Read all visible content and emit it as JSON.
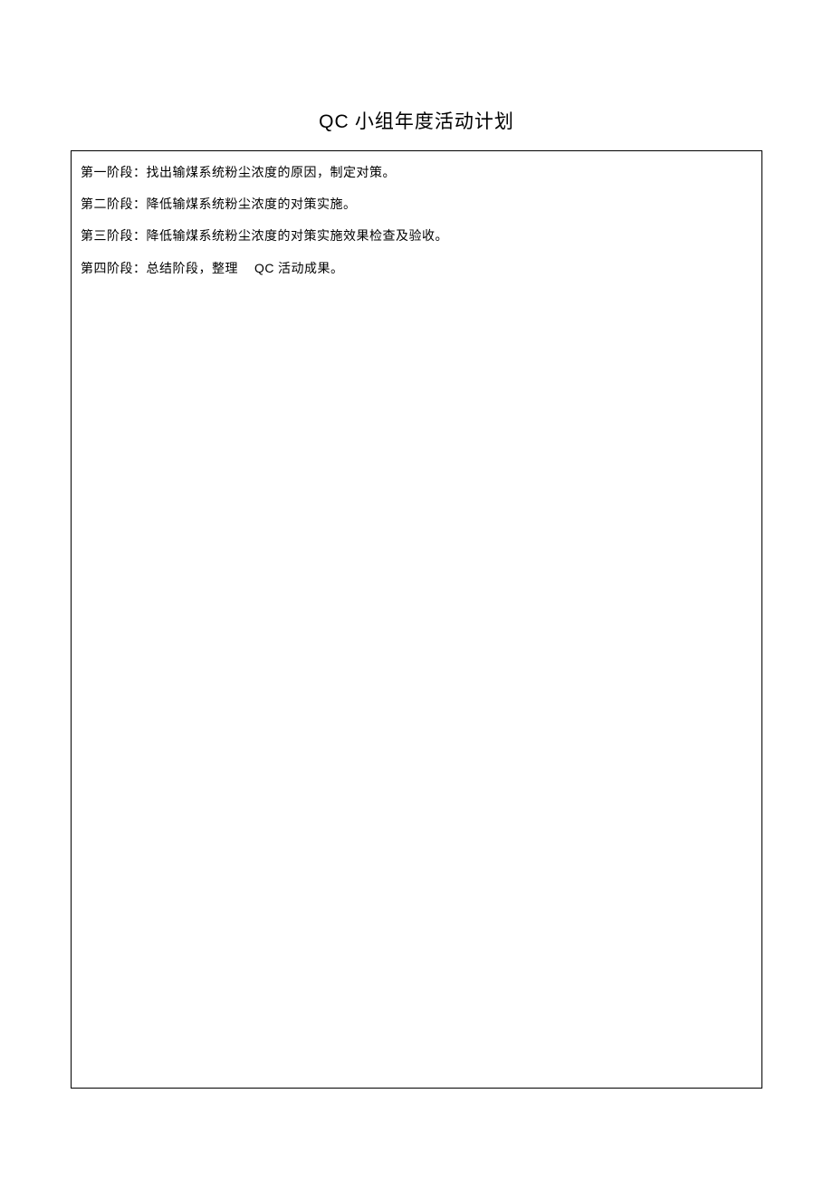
{
  "title": {
    "prefix": "QC",
    "rest": " 小组年度活动计划"
  },
  "stages": [
    {
      "label": "第一阶段：",
      "text": "找出输煤系统粉尘浓度的原因，制定对策。"
    },
    {
      "label": "第二阶段：",
      "text": "降低输煤系统粉尘浓度的对策实施。"
    },
    {
      "label": "第三阶段：",
      "text": "降低输煤系统粉尘浓度的对策实施效果检查及验收。"
    },
    {
      "label": "第四阶段：",
      "text_before": "总结阶段，整理",
      "inline": "QC",
      "text_after": " 活动成果。"
    }
  ]
}
